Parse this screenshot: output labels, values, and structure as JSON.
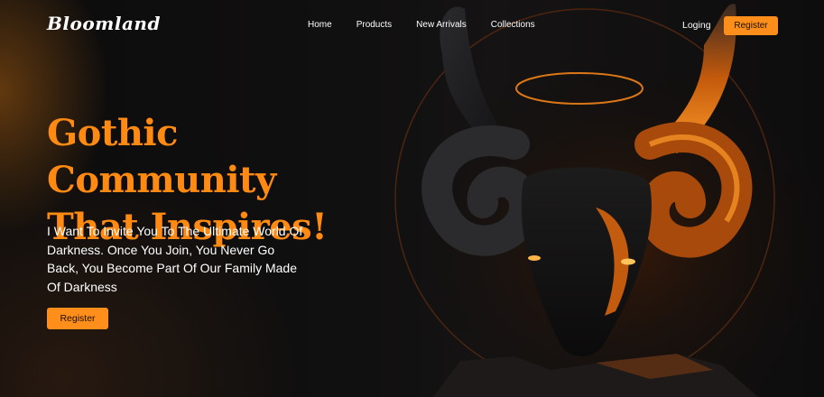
{
  "brand": {
    "logo_text": "Bloomland"
  },
  "nav": {
    "items": [
      {
        "label": "Home"
      },
      {
        "label": "Products"
      },
      {
        "label": "New Arrivals"
      },
      {
        "label": "Collections"
      }
    ],
    "login_label": "Loging",
    "register_label": "Register"
  },
  "hero": {
    "title_line1": "Gothic Community",
    "title_line2": "That Inspires!",
    "description": "I Want To Invite You To The Ultimate World Of Darkness. Once You Join, You Never Go Back, You Become Part Of Our Family Made Of Darkness",
    "cta_label": "Register"
  },
  "colors": {
    "accent": "#ff8f1a",
    "title": "#ff8a12",
    "background": "#0d0c0c"
  }
}
